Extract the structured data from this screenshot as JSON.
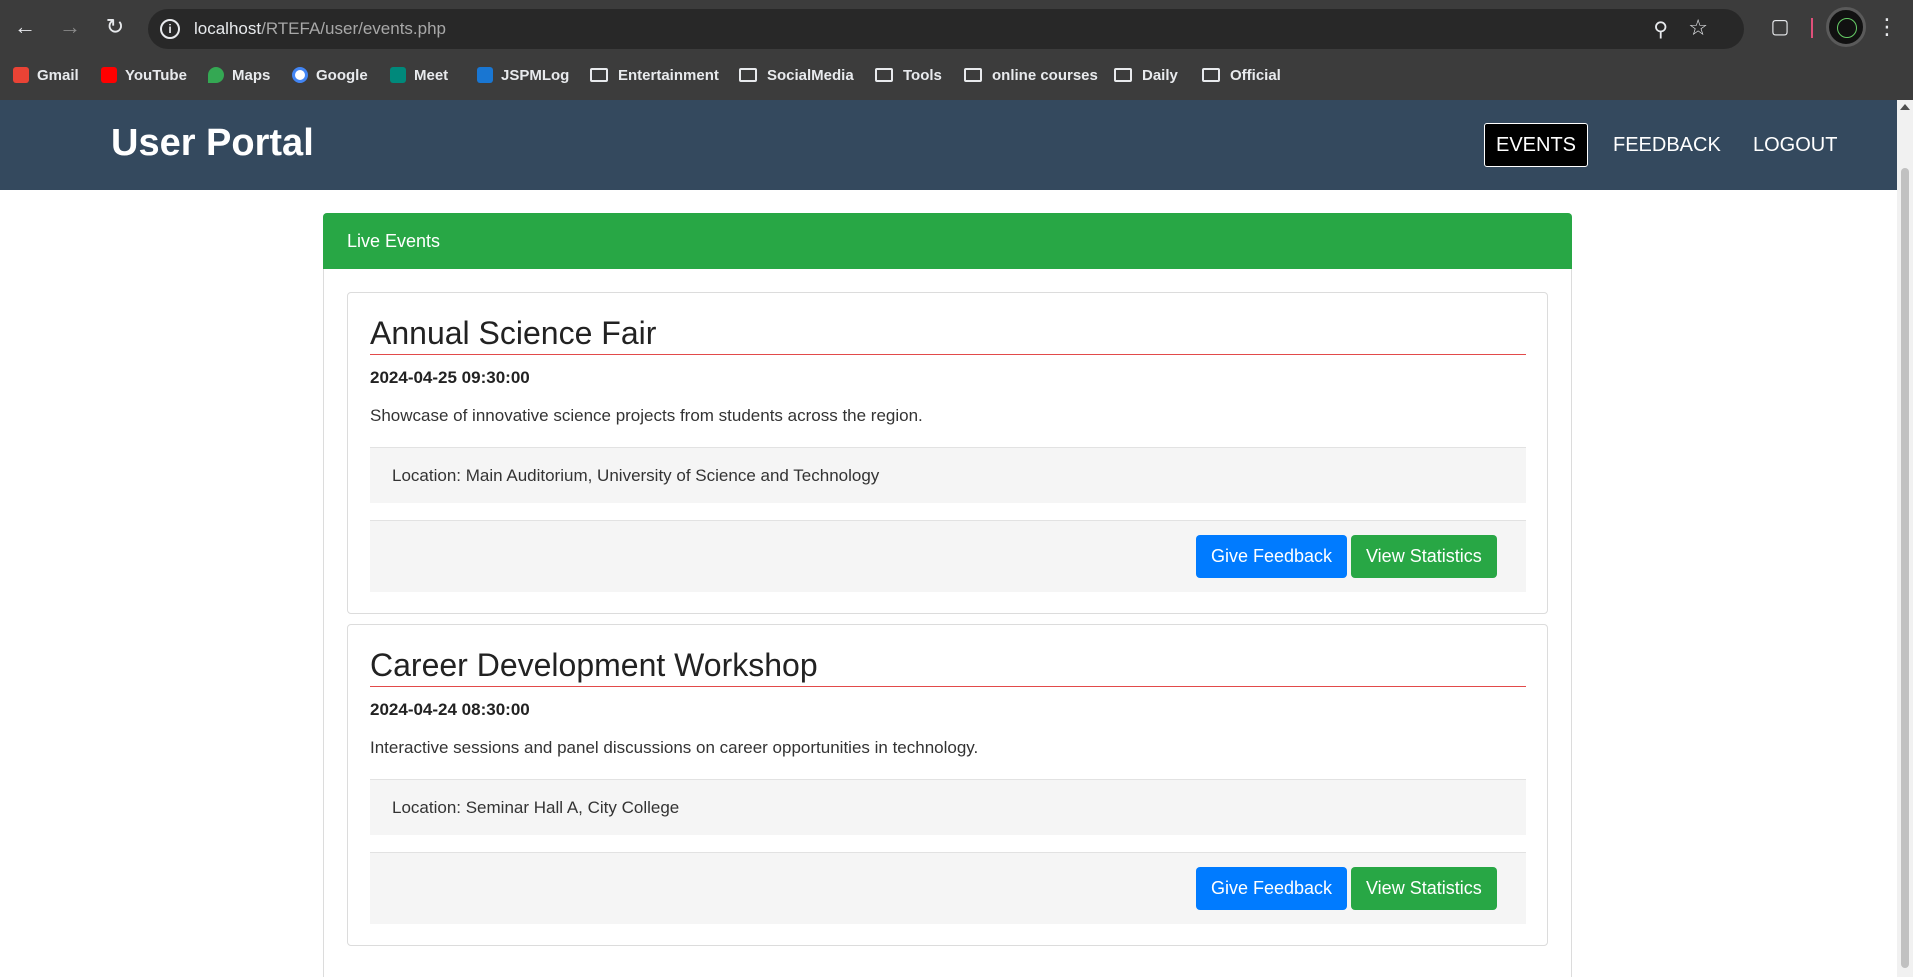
{
  "browser": {
    "url_host": "localhost",
    "url_path": "/RTEFA/user/events.php",
    "bookmarks": [
      {
        "label": "Gmail",
        "icon": "gmail-icon",
        "color": "#ea4335"
      },
      {
        "label": "YouTube",
        "icon": "youtube-icon",
        "color": "#ff0000"
      },
      {
        "label": "Maps",
        "icon": "maps-icon",
        "color": "#34a853"
      },
      {
        "label": "Google",
        "icon": "google-icon",
        "color": "#4285f4"
      },
      {
        "label": "Meet",
        "icon": "meet-icon",
        "color": "#00897b"
      },
      {
        "label": "JSPMLog",
        "icon": "jspmlog-icon",
        "color": "#1976d2"
      },
      {
        "label": "Entertainment",
        "icon": "folder-icon"
      },
      {
        "label": "SocialMedia",
        "icon": "folder-icon"
      },
      {
        "label": "Tools",
        "icon": "folder-icon"
      },
      {
        "label": "online courses",
        "icon": "folder-icon"
      },
      {
        "label": "Daily",
        "icon": "folder-icon"
      },
      {
        "label": "Official",
        "icon": "folder-icon"
      }
    ]
  },
  "header": {
    "brand": "User Portal",
    "nav": [
      {
        "label": "EVENTS",
        "active": true
      },
      {
        "label": "FEEDBACK",
        "active": false
      },
      {
        "label": "LOGOUT",
        "active": false
      }
    ],
    "bg_color": "#34495e"
  },
  "panel": {
    "title": "Live Events",
    "accent_color": "#28a745"
  },
  "events": [
    {
      "title": "Annual Science Fair",
      "datetime": "2024-04-25 09:30:00",
      "description": "Showcase of innovative science projects from students across the region.",
      "location": "Location: Main Auditorium, University of Science and Technology",
      "feedback_label": "Give Feedback",
      "stats_label": "View Statistics"
    },
    {
      "title": "Career Development Workshop",
      "datetime": "2024-04-24 08:30:00",
      "description": "Interactive sessions and panel discussions on career opportunities in technology.",
      "location": "Location: Seminar Hall A, City College",
      "feedback_label": "Give Feedback",
      "stats_label": "View Statistics"
    }
  ]
}
